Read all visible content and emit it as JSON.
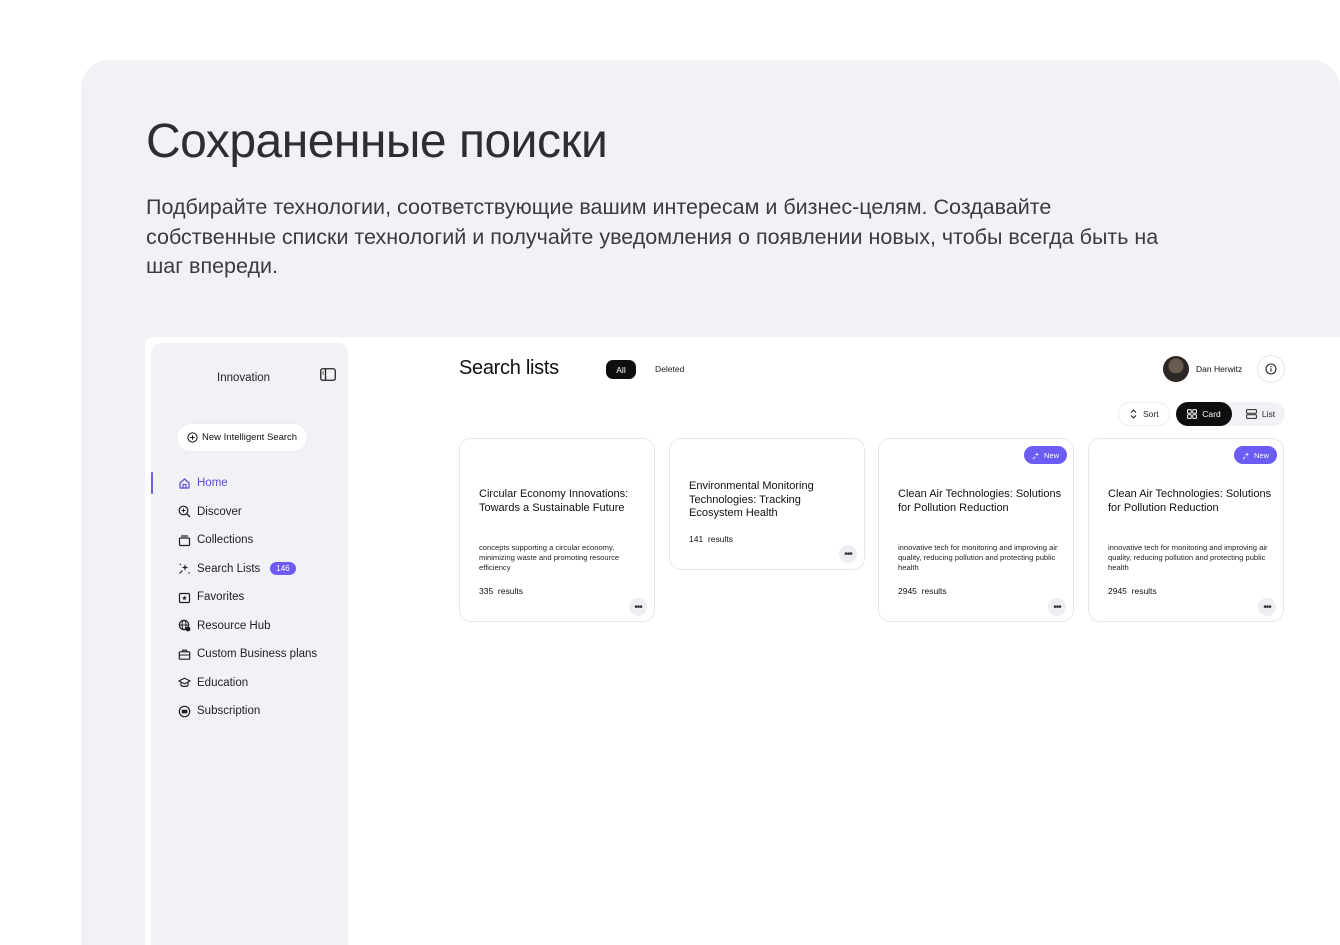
{
  "hero": {
    "title": "Сохраненные поиски",
    "description": "Подбирайте технологии, соответствующие вашим интересам и бизнес-целям. Создавайте собственные списки технологий и получайте уведомления о появлении новых, чтобы всегда быть на шаг впереди."
  },
  "sidebar": {
    "title": "Innovation",
    "new_search_label": "New Intelligent Search",
    "items": [
      {
        "label": "Home",
        "icon": "home-icon",
        "active": true
      },
      {
        "label": "Discover",
        "icon": "discover-icon"
      },
      {
        "label": "Collections",
        "icon": "collections-icon"
      },
      {
        "label": "Search Lists",
        "icon": "sparkle-icon",
        "badge": "146"
      },
      {
        "label": "Favorites",
        "icon": "favorites-icon"
      },
      {
        "label": "Resource Hub",
        "icon": "globe-icon"
      },
      {
        "label": "Custom Business plans",
        "icon": "briefcase-icon"
      },
      {
        "label": "Education",
        "icon": "graduation-cap-icon"
      },
      {
        "label": "Subscription",
        "icon": "subscription-icon"
      }
    ]
  },
  "header": {
    "title": "Search lists",
    "tab_all": "All",
    "tab_deleted": "Deleted",
    "user_name": "Dan Herwitz",
    "sort_label": "Sort",
    "card_label": "Card",
    "list_label": "List"
  },
  "cards": [
    {
      "title": "Circular Economy Innovations: Towards a Sustainable Future",
      "description": "concepts supporting a circular economy, minimizing waste and promoting resource efficiency",
      "results": "335  results",
      "badge": ""
    },
    {
      "title": "Environmental Monitoring Technologies: Tracking Ecosystem Health",
      "description": "",
      "results": "141  results",
      "badge": ""
    },
    {
      "title": "Clean Air Technologies: Solutions for Pollution Reduction",
      "description": "innovative tech for monitoring and improving air quality, reducing pollution and protecting public health",
      "results": "2945  results",
      "badge": "New"
    },
    {
      "title": "Clean Air Technologies: Solutions for Pollution Reduction",
      "description": "innovative tech for monitoring and improving air quality, reducing pollution and protecting public health",
      "results": "2945  results",
      "badge": "New"
    }
  ],
  "colors": {
    "accent": "#6c5cf3",
    "panel_bg": "#f1f2f5",
    "dark": "#0e0e10"
  }
}
